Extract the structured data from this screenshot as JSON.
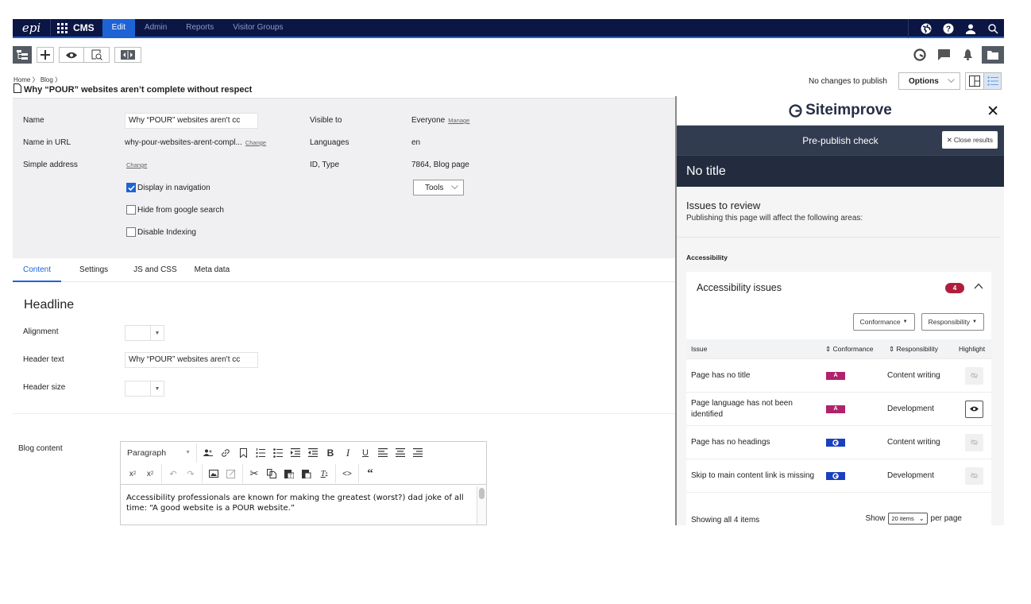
{
  "topnav": {
    "logo": "epi",
    "product": "CMS",
    "items": [
      {
        "label": "Edit",
        "active": true
      },
      {
        "label": "Admin",
        "active": false
      },
      {
        "label": "Reports",
        "active": false
      },
      {
        "label": "Visitor Groups",
        "active": false
      }
    ],
    "right_icons": [
      "globe-icon",
      "help-icon",
      "user-icon",
      "search-icon"
    ]
  },
  "toolbar": {
    "left_icons": [
      "page-tree-icon",
      "add-icon",
      "preview-icon",
      "view-page-icon",
      "compare-icon"
    ],
    "right_icons": [
      "siteimprove-icon",
      "comments-icon",
      "notifications-icon",
      "assets-folder-icon"
    ]
  },
  "breadcrumb": {
    "items": [
      "Home",
      "Blog"
    ],
    "separator": "〉"
  },
  "page": {
    "title": "Why “POUR” websites aren’t complete without respect"
  },
  "publish": {
    "status": "No changes to publish",
    "options_label": "Options"
  },
  "properties": {
    "name_label": "Name",
    "name_value": "Why “POUR” websites aren't cc",
    "url_label": "Name in URL",
    "url_value": "why-pour-websites-arent-compl...",
    "url_change": "Change",
    "simple_label": "Simple address",
    "simple_change": "Change",
    "checkboxes": [
      {
        "label": "Display in navigation",
        "checked": true
      },
      {
        "label": "Hide from google search",
        "checked": false
      },
      {
        "label": "Disable Indexing",
        "checked": false
      }
    ],
    "visible_label": "Visible to",
    "visible_value": "Everyone",
    "visible_manage": "Manage",
    "languages_label": "Languages",
    "languages_value": "en",
    "id_label": "ID, Type",
    "id_value": "7864, Blog page",
    "tools_label": "Tools"
  },
  "tabs": [
    {
      "label": "Content",
      "active": true
    },
    {
      "label": "Settings",
      "active": false
    },
    {
      "label": "JS and CSS",
      "active": false
    },
    {
      "label": "Meta data",
      "active": false
    }
  ],
  "content": {
    "section": "Headline",
    "alignment_label": "Alignment",
    "header_text_label": "Header text",
    "header_text_value": "Why “POUR” websites aren't cc",
    "header_size_label": "Header size",
    "blog_content_label": "Blog content",
    "editor": {
      "format": "Paragraph",
      "body": "Accessibility professionals are known for making the greatest (worst?) dad joke of all time: “A good website is a POUR website.”"
    }
  },
  "siteimprove": {
    "brand": "Siteimprove",
    "bar_title": "Pre-publish check",
    "close_results": "Close results",
    "page_title": "No title",
    "review_title": "Issues to review",
    "review_sub": "Publishing this page will affect the following areas:",
    "section": "Accessibility",
    "card_title": "Accessibility issues",
    "count": "4",
    "filters": [
      "Conformance",
      "Responsibility"
    ],
    "columns": [
      "Issue",
      "Conformance",
      "Responsibility",
      "Highlight"
    ],
    "rows": [
      {
        "issue": "Page has no title",
        "conformance": "A",
        "responsibility": "Content writing",
        "highlight": false
      },
      {
        "issue": "Page language has not been identified",
        "conformance": "A",
        "responsibility": "Development",
        "highlight": true
      },
      {
        "issue": "Page has no headings",
        "conformance": "best-practice",
        "responsibility": "Content writing",
        "highlight": false
      },
      {
        "issue": "Skip to main content link is missing",
        "conformance": "best-practice",
        "responsibility": "Development",
        "highlight": false
      }
    ],
    "footer": {
      "showing": "Showing all 4 items",
      "show": "Show",
      "per_page_value": "20 items",
      "per_page": "per page"
    },
    "colors": {
      "level_a": "#b0226a",
      "best_practice": "#1a3fbf",
      "count_badge": "#b01e3c"
    }
  }
}
